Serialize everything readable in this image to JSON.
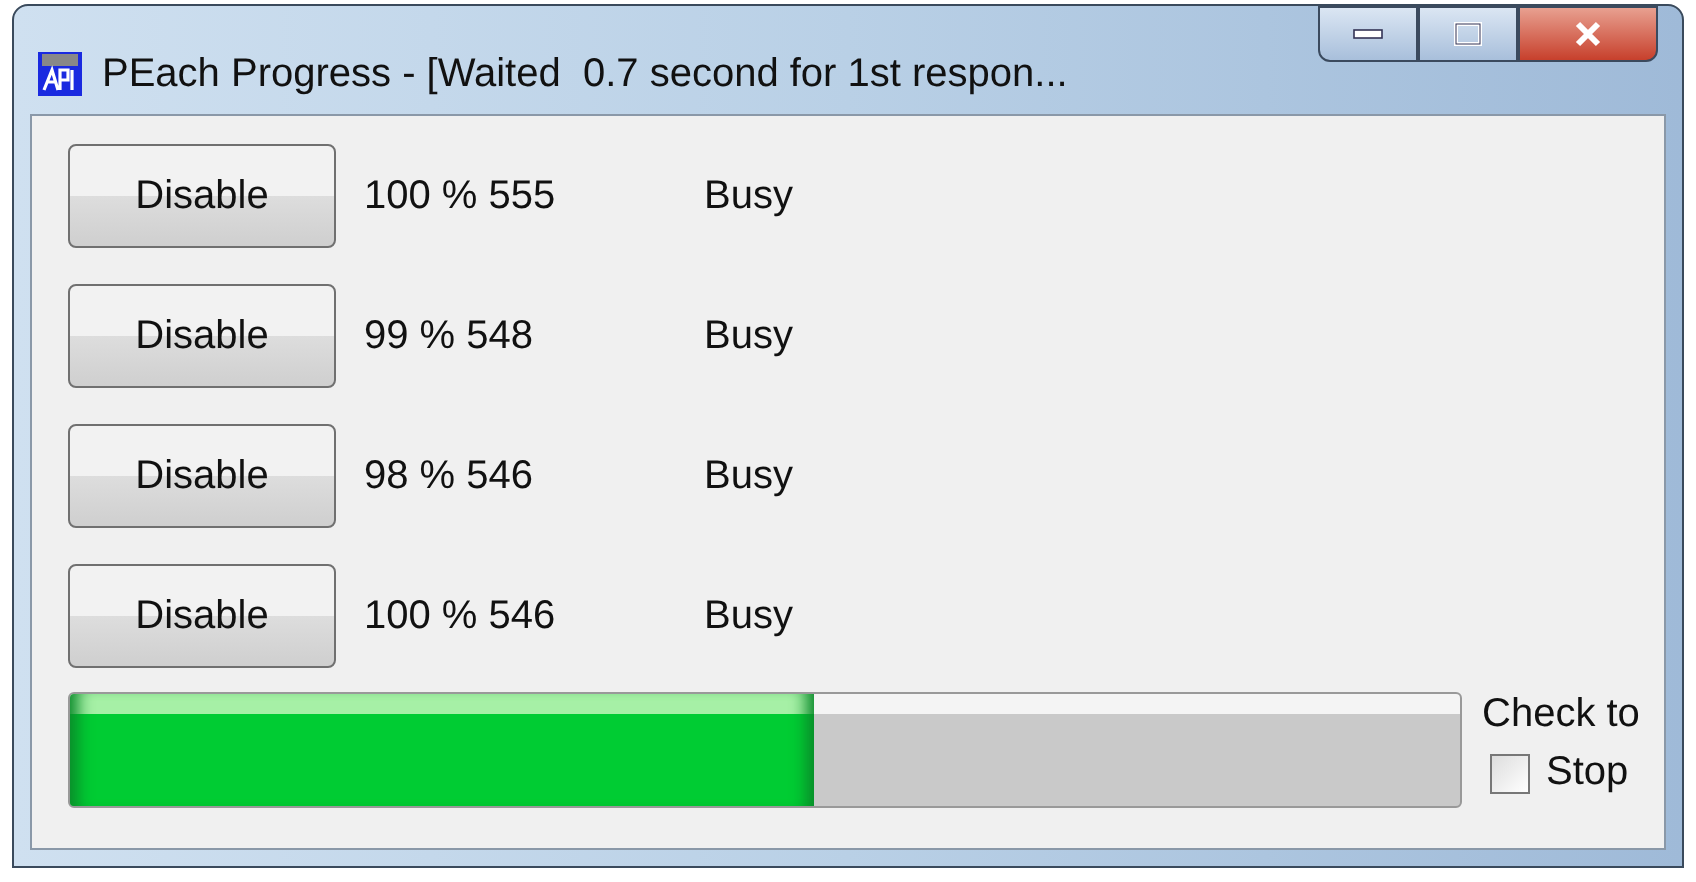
{
  "window": {
    "title": "PEach Progress - [Waited  0.7 second for 1st respon..."
  },
  "rows": [
    {
      "button": "Disable",
      "progress": "100 % 555",
      "status": "Busy"
    },
    {
      "button": "Disable",
      "progress": "99 % 548",
      "status": "Busy"
    },
    {
      "button": "Disable",
      "progress": "98 % 546",
      "status": "Busy"
    },
    {
      "button": "Disable",
      "progress": "100 % 546",
      "status": "Busy"
    }
  ],
  "progress_bar": {
    "level": 0.535
  },
  "stop_checkbox": {
    "label_line_1": "Check to",
    "label_line_2": "Stop",
    "checked": false
  }
}
